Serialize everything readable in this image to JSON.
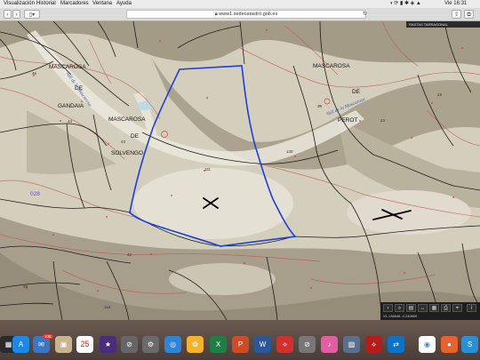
{
  "menubar": {
    "items": [
      "Visualización",
      "Historial",
      "Marcadores",
      "Ventana",
      "Ayuda"
    ],
    "clock": "Vie 16:31"
  },
  "browser": {
    "url": "www1.sedecatastro.gob.es",
    "banner": "RASTAS TARRAGONAL"
  },
  "map": {
    "labels": {
      "mascarosa_gandaia_1": "MASCAROSA",
      "mascarosa_gandaia_2": "DE",
      "mascarosa_gandaia_3": "GANDAIA",
      "mascarosa_solvengo_1": "MASCAROSA",
      "mascarosa_solvengo_2": "DE",
      "mascarosa_solvengo_3": "SOLVENGO",
      "mascarosa_perot_1": "MASCAROSA",
      "mascarosa_perot_2": "DE",
      "mascarosa_perot_3": "PEROT",
      "vall_1": "Vall de la Mascarosa",
      "vall_2": "Vall de la Mascarosa",
      "blue_label": "028"
    },
    "parcel_numbers": [
      "46",
      "44",
      "43",
      "111",
      "130",
      "24",
      "23",
      "22",
      "42",
      "49",
      "116"
    ],
    "coords": "X1,136846, 0.240800"
  },
  "dock": {
    "calendar_day": "25",
    "badge": "108"
  }
}
